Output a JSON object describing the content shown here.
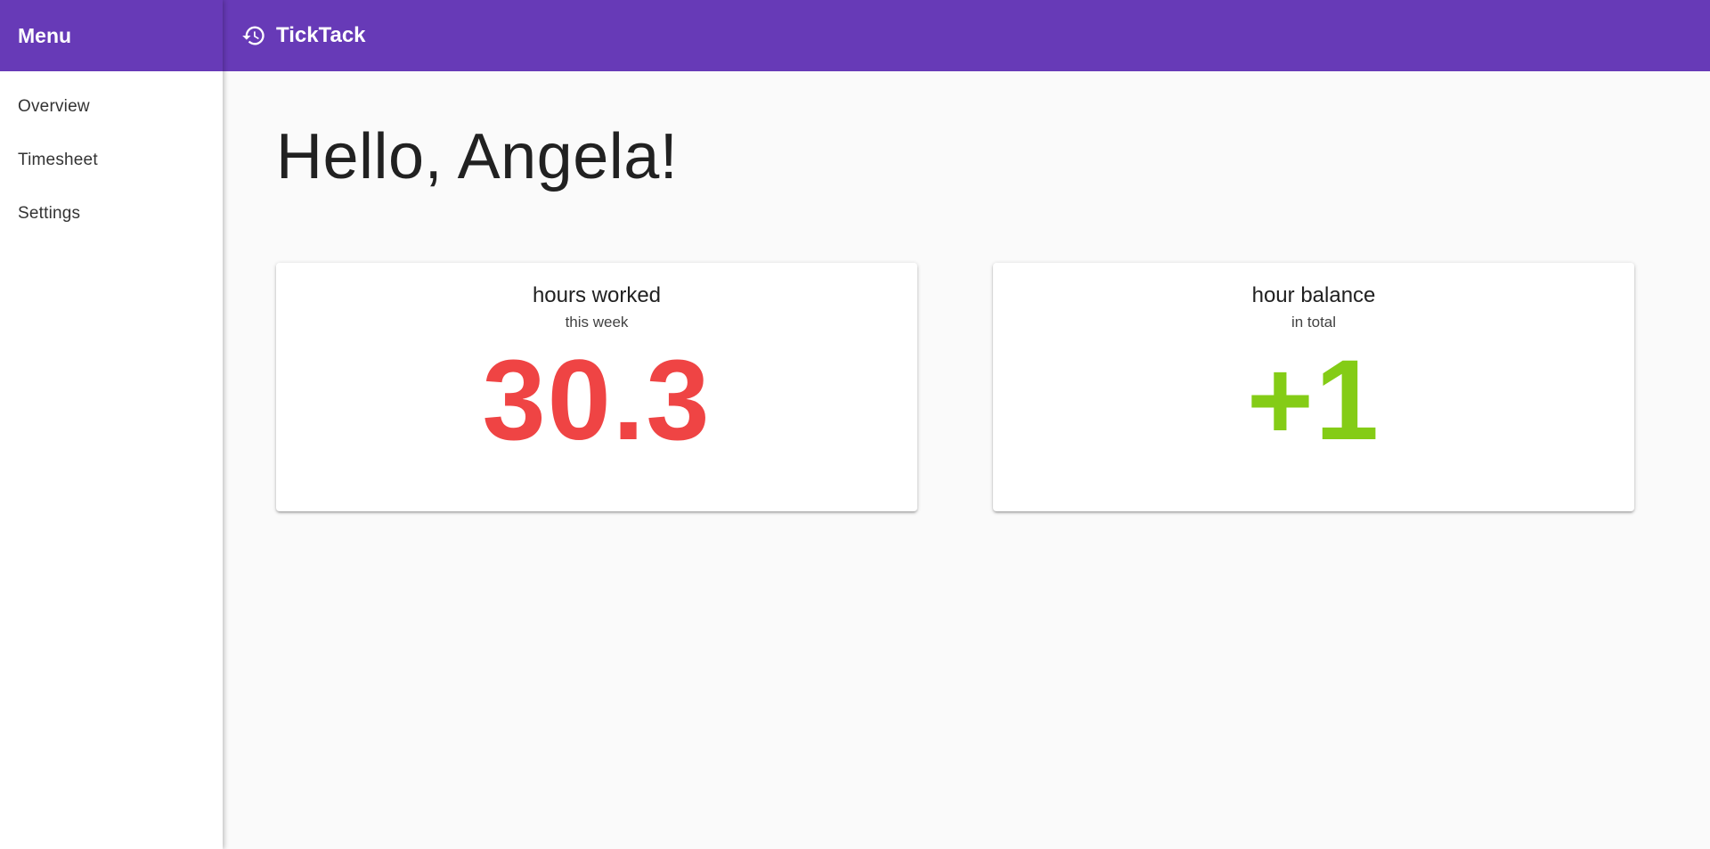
{
  "sidebar": {
    "header": "Menu",
    "items": [
      {
        "label": "Overview"
      },
      {
        "label": "Timesheet"
      },
      {
        "label": "Settings"
      }
    ]
  },
  "topbar": {
    "icon": "history-icon",
    "title": "TickTack"
  },
  "main": {
    "greeting": "Hello, Angela!",
    "cards": [
      {
        "title": "hours worked",
        "subtitle": "this week",
        "value": "30.3",
        "color": "#ef4444"
      },
      {
        "title": "hour balance",
        "subtitle": "in total",
        "value": "+1",
        "color": "#84cc16"
      }
    ]
  },
  "colors": {
    "primary": "#673ab7",
    "background": "#fafafa",
    "negative": "#ef4444",
    "positive": "#84cc16"
  }
}
